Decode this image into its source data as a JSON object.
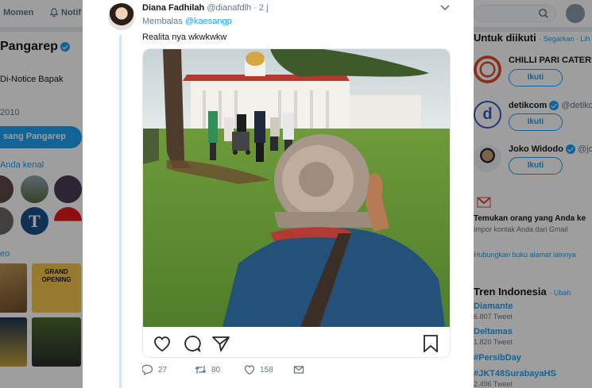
{
  "nav": {
    "moments_label": "Momen",
    "notifications_label": "Notif"
  },
  "left": {
    "name": "Pangarep",
    "bio": "Di-Notice Bapak",
    "joined": "2010",
    "follow_button": "sang Pangarep",
    "you_know": "Anda kenal",
    "media_label": "eo",
    "grand_opening": "GRAND OPENING"
  },
  "tweet": {
    "author_name": "Diana Fadhilah",
    "author_handle": "@dianafdlh",
    "time": "· 2 j",
    "reply_prefix": "Membalas",
    "reply_mention": "@kaesangp",
    "text": "Realita nya wkwkwkw",
    "replies": "27",
    "retweets": "80",
    "likes": "158"
  },
  "sidebar": {
    "who_to_follow_title": "Untuk diikuti",
    "who_to_follow_links": "· Segarkan · Lih",
    "follow_label": "Ikuti",
    "suggestions": [
      {
        "name": "CHILLI PARI CATERIN",
        "handle": ""
      },
      {
        "name": "detikcom",
        "handle": "@detikco"
      },
      {
        "name": "Joko Widodo",
        "handle": "@jok"
      }
    ],
    "contacts_title": "Temukan orang yang Anda ke",
    "contacts_sub": "Impor kontak Anda dari Gmail",
    "connect_link": "Hubungkan buku alamat lainnya",
    "trends_title": "Tren Indonesia",
    "trends_change": "· Ubah",
    "trends": [
      {
        "name": "Diamante",
        "count": "6.807 Tweet"
      },
      {
        "name": "Deltamas",
        "count": "1.820 Tweet"
      },
      {
        "name": "#PersibDay",
        "count": ""
      },
      {
        "name": "#JKT48SurabayaHS",
        "count": "2.496 Tweet"
      }
    ]
  },
  "colors": {
    "accent": "#1da1f2",
    "text": "#14171a",
    "muted": "#657786",
    "border": "#e1e8ed"
  },
  "icons": [
    "bell-icon",
    "search-icon",
    "verified-icon",
    "chevron-down-icon",
    "heart-icon",
    "comment-icon",
    "send-icon",
    "bookmark-icon",
    "reply-icon",
    "retweet-icon",
    "like-icon",
    "dm-icon",
    "gmail-icon"
  ]
}
